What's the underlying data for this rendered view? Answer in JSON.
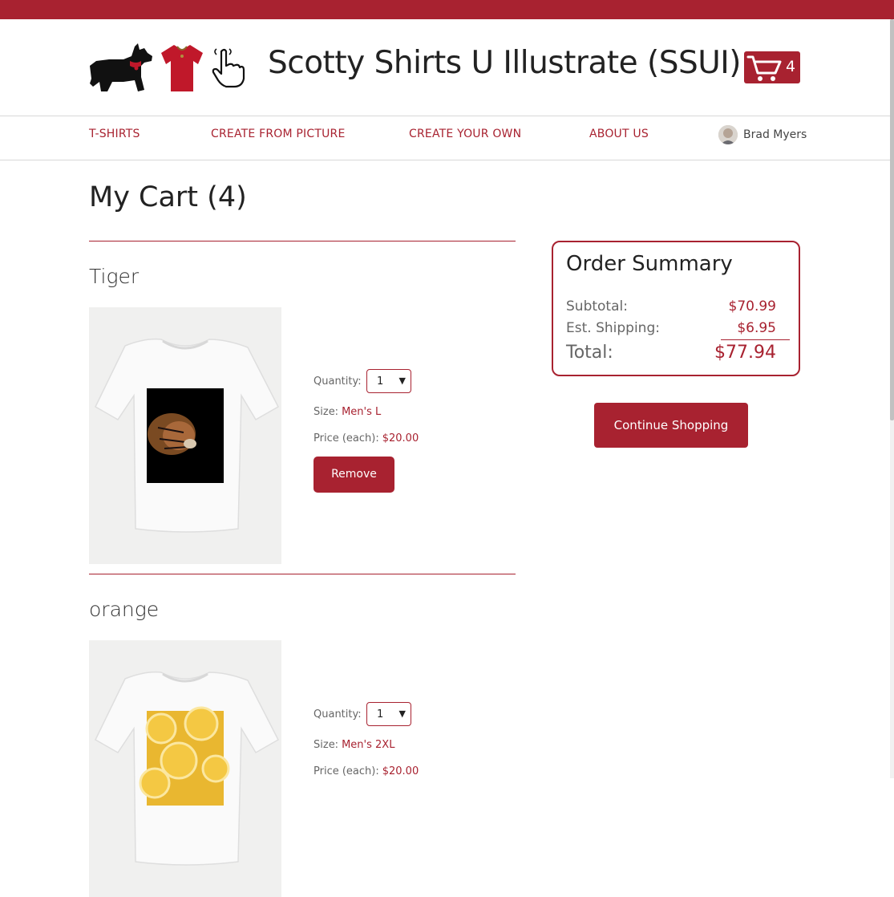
{
  "site": {
    "title": "Scotty Shirts U Illustrate (SSUI)",
    "cart_count": "4"
  },
  "nav": {
    "items": [
      "T-SHIRTS",
      "CREATE FROM PICTURE",
      "CREATE YOUR OWN",
      "ABOUT US"
    ],
    "user_name": "Brad Myers"
  },
  "page": {
    "title": "My Cart (4)"
  },
  "cart_items": [
    {
      "name": "Tiger",
      "quantity_label": "Quantity:",
      "quantity": "1",
      "size_label": "Size:",
      "size": "Men's L",
      "price_label": "Price (each):",
      "price": "$20.00",
      "remove_label": "Remove"
    },
    {
      "name": "orange",
      "quantity_label": "Quantity:",
      "quantity": "1",
      "size_label": "Size:",
      "size": "Men's 2XL",
      "price_label": "Price (each):",
      "price": "$20.00"
    }
  ],
  "summary": {
    "title": "Order Summary",
    "subtotal_label": "Subtotal:",
    "subtotal": "$70.99",
    "shipping_label": "Est. Shipping:",
    "shipping": "$6.95",
    "total_label": "Total:",
    "total": "$77.94"
  },
  "continue_label": "Continue Shopping",
  "colors": {
    "brand": "#a82230",
    "text": "#222222",
    "muted": "#666666"
  },
  "icons": [
    "scottie-dog-logo-icon",
    "shirt-logo-icon",
    "pointing-hand-icon",
    "shopping-cart-icon",
    "chevron-down-icon"
  ]
}
